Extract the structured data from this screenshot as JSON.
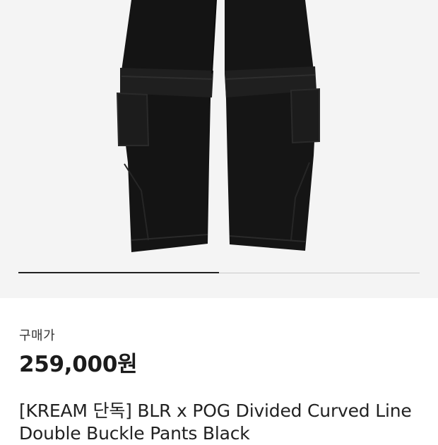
{
  "product": {
    "image_alt": "black cargo pants",
    "buy_label": "구매가",
    "price": "259,000원",
    "title": "[KREAM 단독] BLR x POG Divided Curved Line Double Buckle Pants Black",
    "carousel_progress": 0.5
  },
  "colors": {
    "image_background": "#f4f4f4",
    "pants": "#151515",
    "indicator_active": "#222222",
    "indicator_track": "#c9c9c9"
  }
}
